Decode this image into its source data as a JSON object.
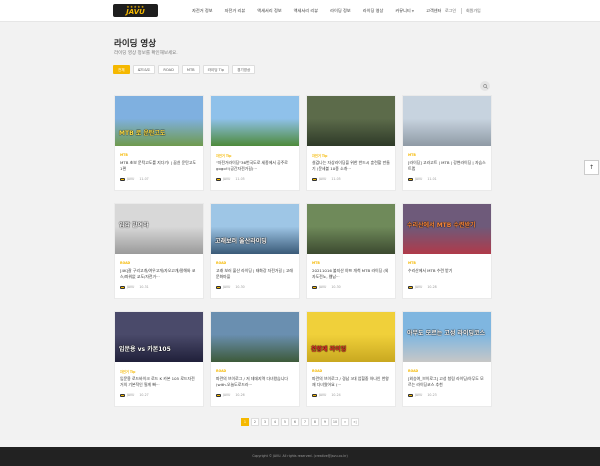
{
  "header": {
    "logo_text": "JAVU",
    "logo_stars": "★★★★★",
    "nav": [
      {
        "label": "자전거 정보",
        "caret": ""
      },
      {
        "label": "자전거 리뷰",
        "caret": ""
      },
      {
        "label": "액세서리 정보",
        "caret": ""
      },
      {
        "label": "액세서리 리뷰",
        "caret": ""
      },
      {
        "label": "라이딩 정보",
        "caret": ""
      },
      {
        "label": "라이딩 영상",
        "caret": ""
      },
      {
        "label": "커뮤니티",
        "caret": "▼"
      },
      {
        "label": "고객센터",
        "caret": ""
      }
    ],
    "login": "로그인",
    "signup": "회원가입"
  },
  "page": {
    "title": "라이딩 영상",
    "subtitle": "라이딩 영상 정보를 확인해보세요."
  },
  "filters": [
    "전체",
    "로드&도",
    "ROAD",
    "MTB",
    "라이딩 Tip",
    "경기영상"
  ],
  "cards": [
    {
      "category": "MTB",
      "title": "MTB 초보 문턱고도를 지다기! | 꿈쉰 운탄고도 1편",
      "author": "JAVU",
      "date": "11-07",
      "colors": [
        "#7fb0e0",
        "#6f9a4e"
      ],
      "overlay": "MTB 로 운탄고도",
      "ov_color": "#ffe14a"
    },
    {
      "category": "자전거 Tip",
      "title": "\"자전거라이딩\"36번국도로 세종에서 공주로 gogo!!(공간자전거길)···",
      "author": "JAVU",
      "date": "11-05",
      "colors": [
        "#8fc1ea",
        "#4d8a3a"
      ],
      "overlay": "",
      "ov_color": "#ffffff"
    },
    {
      "category": "자전거 Tip",
      "title": "설겂나는 자상라이딩을 위한 반드시 훈련할 만들기 (문세볼 10종 소개···",
      "author": "JAVU",
      "date": "11-05",
      "colors": [
        "#5c6b4a",
        "#2e3a28"
      ],
      "overlay": "",
      "ov_color": "#ffffff"
    },
    {
      "category": "MTB",
      "title": "[라이딩] 고라고트 | MTB | 강변라이딩 | 자습스트랩",
      "author": "JAVU",
      "date": "11-01",
      "colors": [
        "#c7d3df",
        "#8f9aa5"
      ],
      "overlay": "",
      "ov_color": "#ffffff"
    },
    {
      "category": "ROAD",
      "title": "[4K]잘 구리고개/여우고개/자오고개/말해와 코스/파워없 교도/자전거···",
      "author": "JAVU",
      "date": "10-31",
      "colors": [
        "#d8d8d8",
        "#9a9a9a"
      ],
      "overlay": "입감 말여하",
      "ov_color": "#ffffff"
    },
    {
      "category": "ROAD",
      "title": "고래 보러 울산 라이딩 | 태화강 자전거길 | 고래 문화마을",
      "author": "JAVU",
      "date": "10-30",
      "colors": [
        "#9ec6e6",
        "#3a5a78"
      ],
      "overlay": "고래보러 울산라이딩",
      "ov_color": "#ffffff"
    },
    {
      "category": "MTB",
      "title": "20211016 불지산 야프 개척 MTB 라이딩 (외자도전노, 웹남···",
      "author": "JAVU",
      "date": "10-30",
      "colors": [
        "#6f8a5a",
        "#3c4a30"
      ],
      "overlay": "",
      "ov_color": "#ffffff"
    },
    {
      "category": "MTB",
      "title": "수리산에서 MTB 수련 받기",
      "author": "JAVU",
      "date": "10-28",
      "colors": [
        "#6e5a7a",
        "#b03a4a"
      ],
      "overlay": "수리산에서 MTB 수련받기",
      "ov_color": "#ff8a3d"
    },
    {
      "category": "자전거 Tip",
      "title": "입문용 로드바이크 로드 K 카본 105 로드자전거의 기본적인 필게 빠···",
      "author": "JAVU",
      "date": "10-27",
      "colors": [
        "#4a4a6a",
        "#20203a"
      ],
      "overlay": "입문용 vs 카본105",
      "ov_color": "#ffffff"
    },
    {
      "category": "ROAD",
      "title": "파란의 브이로그 / 저 데데지역 다녀왔습니다 (with.오늘도로드라···",
      "author": "JAVU",
      "date": "10-26",
      "colors": [
        "#6a8fb0",
        "#3d5a3a"
      ],
      "overlay": "",
      "ov_color": "#ffffff"
    },
    {
      "category": "ROAD",
      "title": "파란의 브이로그 / 경남 3대 업힐중 하나인 천왕재 다녀왔어요 (···",
      "author": "JAVU",
      "date": "10-24",
      "colors": [
        "#f0d03a",
        "#c9a820"
      ],
      "overlay": "천왕재 라이딩",
      "ov_color": "#e8332a"
    },
    {
      "category": "ROAD",
      "title": "[외승여_브이로그] 고성 청림 라이딩/아무도 모르는 라이딩코스 추천",
      "author": "JAVU",
      "date": "10-23",
      "colors": [
        "#7fb6e0",
        "#c7c7c7"
      ],
      "overlay": "아무도 모르는 고성 라이딩코스",
      "ov_color": "#ffffff"
    }
  ],
  "pagination": [
    "1",
    "2",
    "3",
    "4",
    "5",
    "6",
    "7",
    "8",
    "9",
    "10",
    "»",
    "»|"
  ],
  "footer": "Copyright © JAVU. All rights reserved. (creative@javu.co.kr)",
  "scroll_top": "↑"
}
